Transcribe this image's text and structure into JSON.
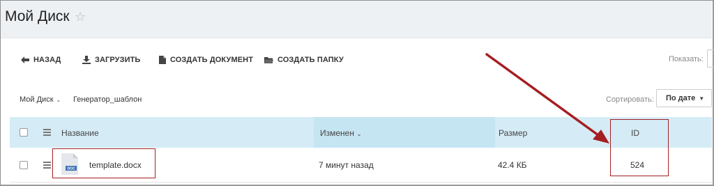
{
  "page": {
    "title": "Мой Диск",
    "star_glyph": "☆"
  },
  "toolbar": {
    "back_label": "НАЗАД",
    "upload_label": "ЗАГРУЗИТЬ",
    "create_doc_label": "СОЗДАТЬ ДОКУМЕНТ",
    "create_folder_label": "СОЗДАТЬ ПАПКУ",
    "show_label": "Показать:"
  },
  "breadcrumb": {
    "items": [
      {
        "label": "Мой Диск",
        "chevron": "⌄"
      },
      {
        "label": "Генератор_шаблон"
      }
    ],
    "sort_label": "Сортировать:",
    "sort_value": "По дате",
    "sort_chevron": "▼"
  },
  "table": {
    "columns": {
      "name": "Название",
      "changed": "Изменен",
      "changed_chevron": "⌄",
      "size": "Размер",
      "id": "ID"
    },
    "rows": [
      {
        "name": "template.docx",
        "changed": "7 минут назад",
        "size": "42.4 КБ",
        "id": "524",
        "file_badge": "DOC"
      }
    ]
  },
  "colors": {
    "header_bg": "#d5ecf6",
    "header_active_bg": "#c6e5f3",
    "annotation": "#a41e22",
    "title_bar_bg": "#eef1f4"
  },
  "icons": [
    "star-icon",
    "back-arrow-icon",
    "upload-icon",
    "document-icon",
    "folder-icon",
    "chevron-down-icon",
    "menu-icon",
    "checkbox-icon",
    "docx-file-icon"
  ]
}
